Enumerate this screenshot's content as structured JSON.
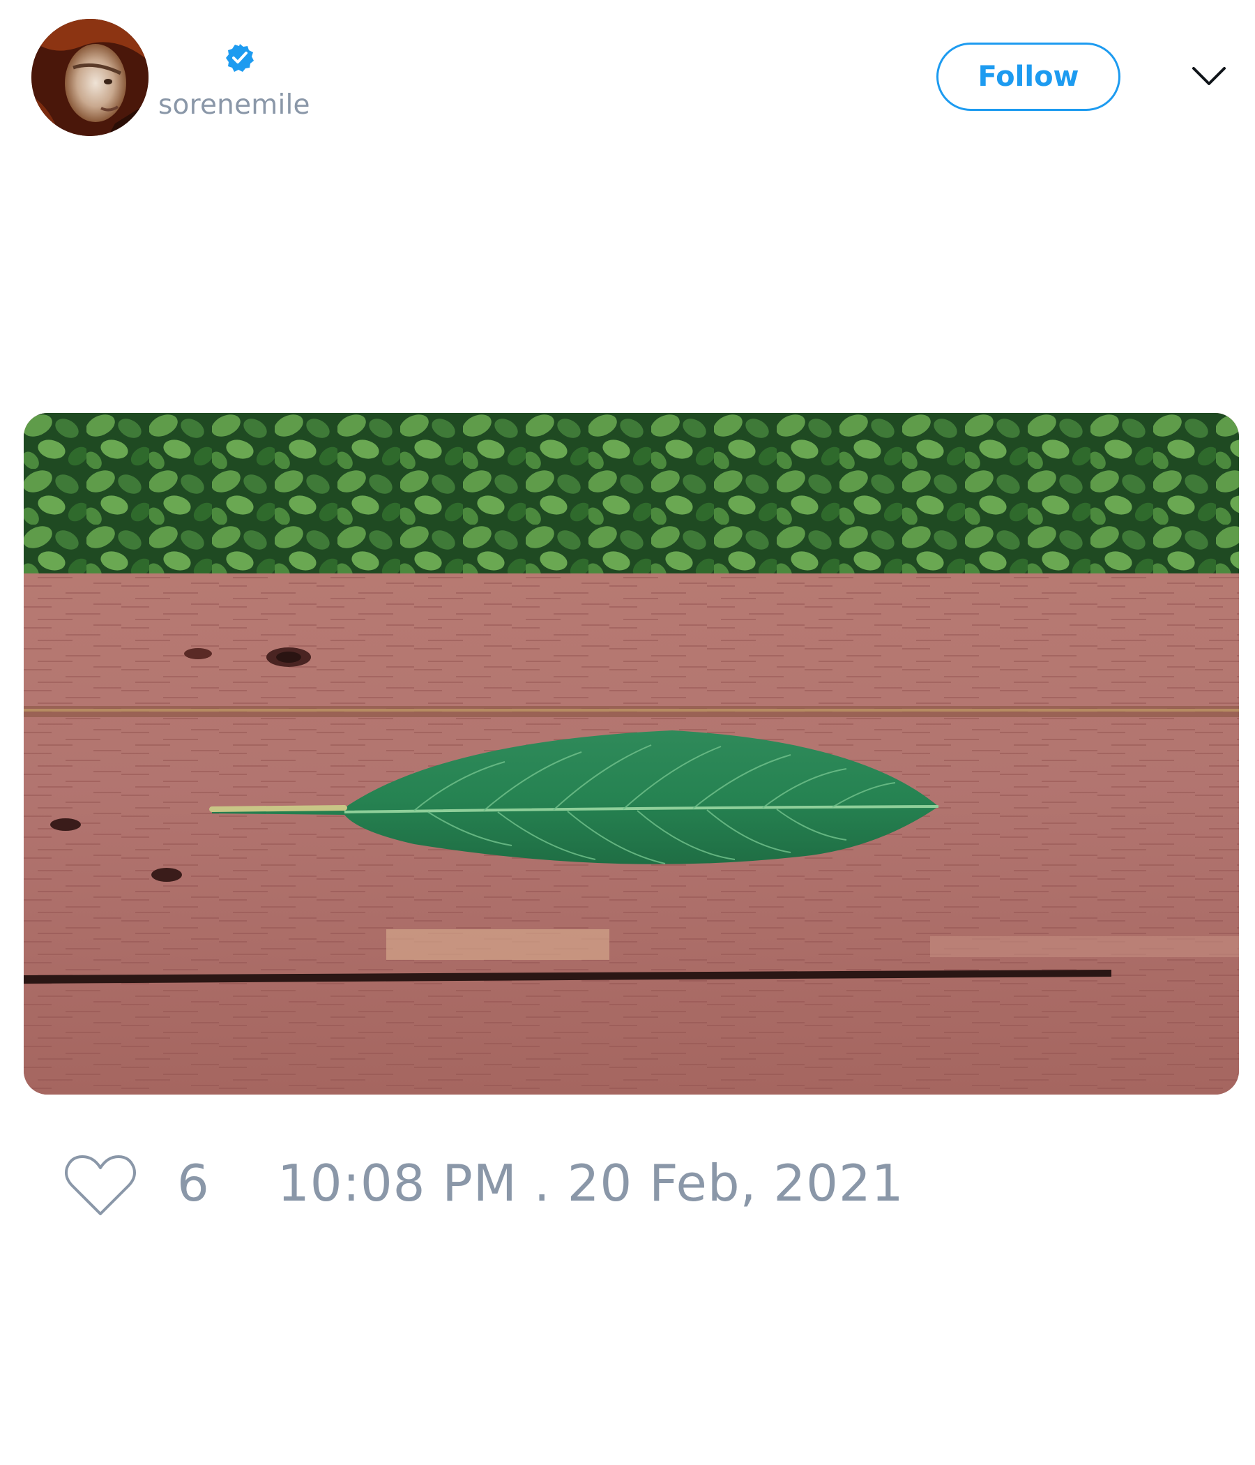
{
  "header": {
    "display_name": "",
    "username": "sorenemile",
    "verified": true,
    "follow_label": "Follow",
    "avatar_icon": "user-avatar",
    "menu_icon": "chevron-down-icon"
  },
  "media": {
    "image_icon": "photo-leaf-on-wooden-bench"
  },
  "footer": {
    "like_icon": "heart-outline-icon",
    "like_count": "6",
    "timestamp": "10:08 PM . 20 Feb, 2021"
  },
  "colors": {
    "accent": "#1d9bf0",
    "muted_text": "#8a97a8",
    "background": "#ffffff"
  }
}
